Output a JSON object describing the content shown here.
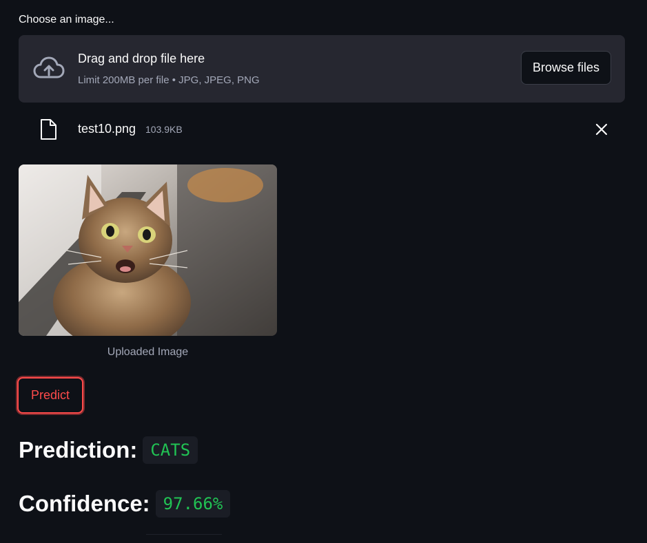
{
  "uploader": {
    "label": "Choose an image...",
    "dropzone_title": "Drag and drop file here",
    "dropzone_subtitle": "Limit 200MB per file • JPG, JPEG, PNG",
    "browse_label": "Browse files",
    "icon": "cloud-upload-icon"
  },
  "file": {
    "name": "test10.png",
    "size": "103.9KB",
    "icon": "file-icon",
    "remove_icon": "close-icon"
  },
  "image": {
    "caption": "Uploaded Image"
  },
  "actions": {
    "predict_label": "Predict"
  },
  "result": {
    "prediction_label": "Prediction:",
    "prediction_value": "CATS",
    "confidence_label": "Confidence:",
    "confidence_value": "97.66%"
  },
  "colors": {
    "background": "#0e1117",
    "dropzone": "#262730",
    "accent": "#ff4b4b",
    "code_green": "#21c354"
  }
}
